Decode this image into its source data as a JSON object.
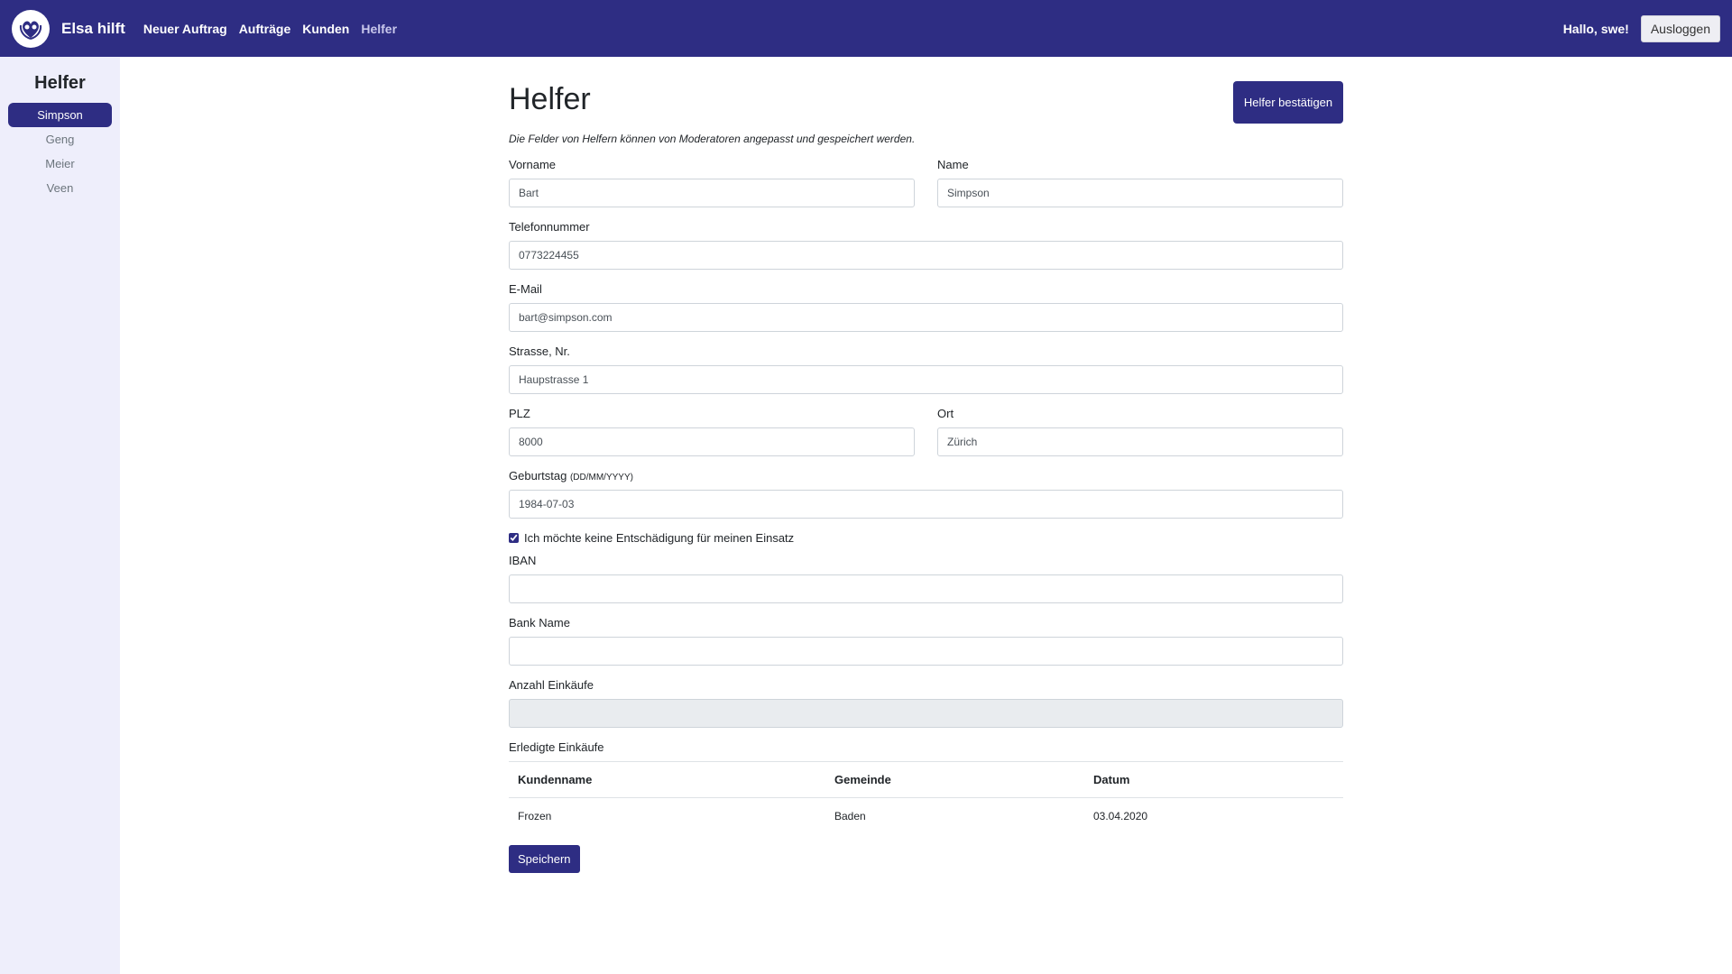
{
  "nav": {
    "brand": "Elsa hilft",
    "links": [
      "Neuer Auftrag",
      "Aufträge",
      "Kunden",
      "Helfer"
    ],
    "greeting": "Hallo, swe!",
    "logout": "Ausloggen",
    "logo_icon": "heart-hands-icon"
  },
  "sidebar": {
    "title": "Helfer",
    "items": [
      "Simpson",
      "Geng",
      "Meier",
      "Veen"
    ],
    "active": "Simpson"
  },
  "page": {
    "title": "Helfer",
    "description": "Die Felder von Helfern können von Moderatoren angepasst und gespeichert werden.",
    "confirm_button": "Helfer bestätigen"
  },
  "form": {
    "vorname": {
      "label": "Vorname",
      "value": "Bart"
    },
    "name": {
      "label": "Name",
      "value": "Simpson"
    },
    "telefon": {
      "label": "Telefonnummer",
      "value": "0773224455"
    },
    "email": {
      "label": "E-Mail",
      "value": "bart@simpson.com"
    },
    "strasse": {
      "label": "Strasse, Nr.",
      "value": "Haupstrasse 1"
    },
    "plz": {
      "label": "PLZ",
      "value": "8000"
    },
    "ort": {
      "label": "Ort",
      "value": "Zürich"
    },
    "geburtstag": {
      "label": "Geburtstag",
      "hint": "(DD/MM/YYYY)",
      "value": "1984-07-03"
    },
    "no_compensation": {
      "label": "Ich möchte keine Entschädigung für meinen Einsatz",
      "checked": true
    },
    "iban": {
      "label": "IBAN",
      "value": ""
    },
    "bank_name": {
      "label": "Bank Name",
      "value": ""
    },
    "anzahl_einkaeufe": {
      "label": "Anzahl Einkäufe",
      "value": ""
    }
  },
  "purchases": {
    "label": "Erledigte Einkäufe",
    "headers": [
      "Kundenname",
      "Gemeinde",
      "Datum"
    ],
    "rows": [
      [
        "Frozen",
        "Baden",
        "03.04.2020"
      ]
    ]
  },
  "save_button": "Speichern"
}
